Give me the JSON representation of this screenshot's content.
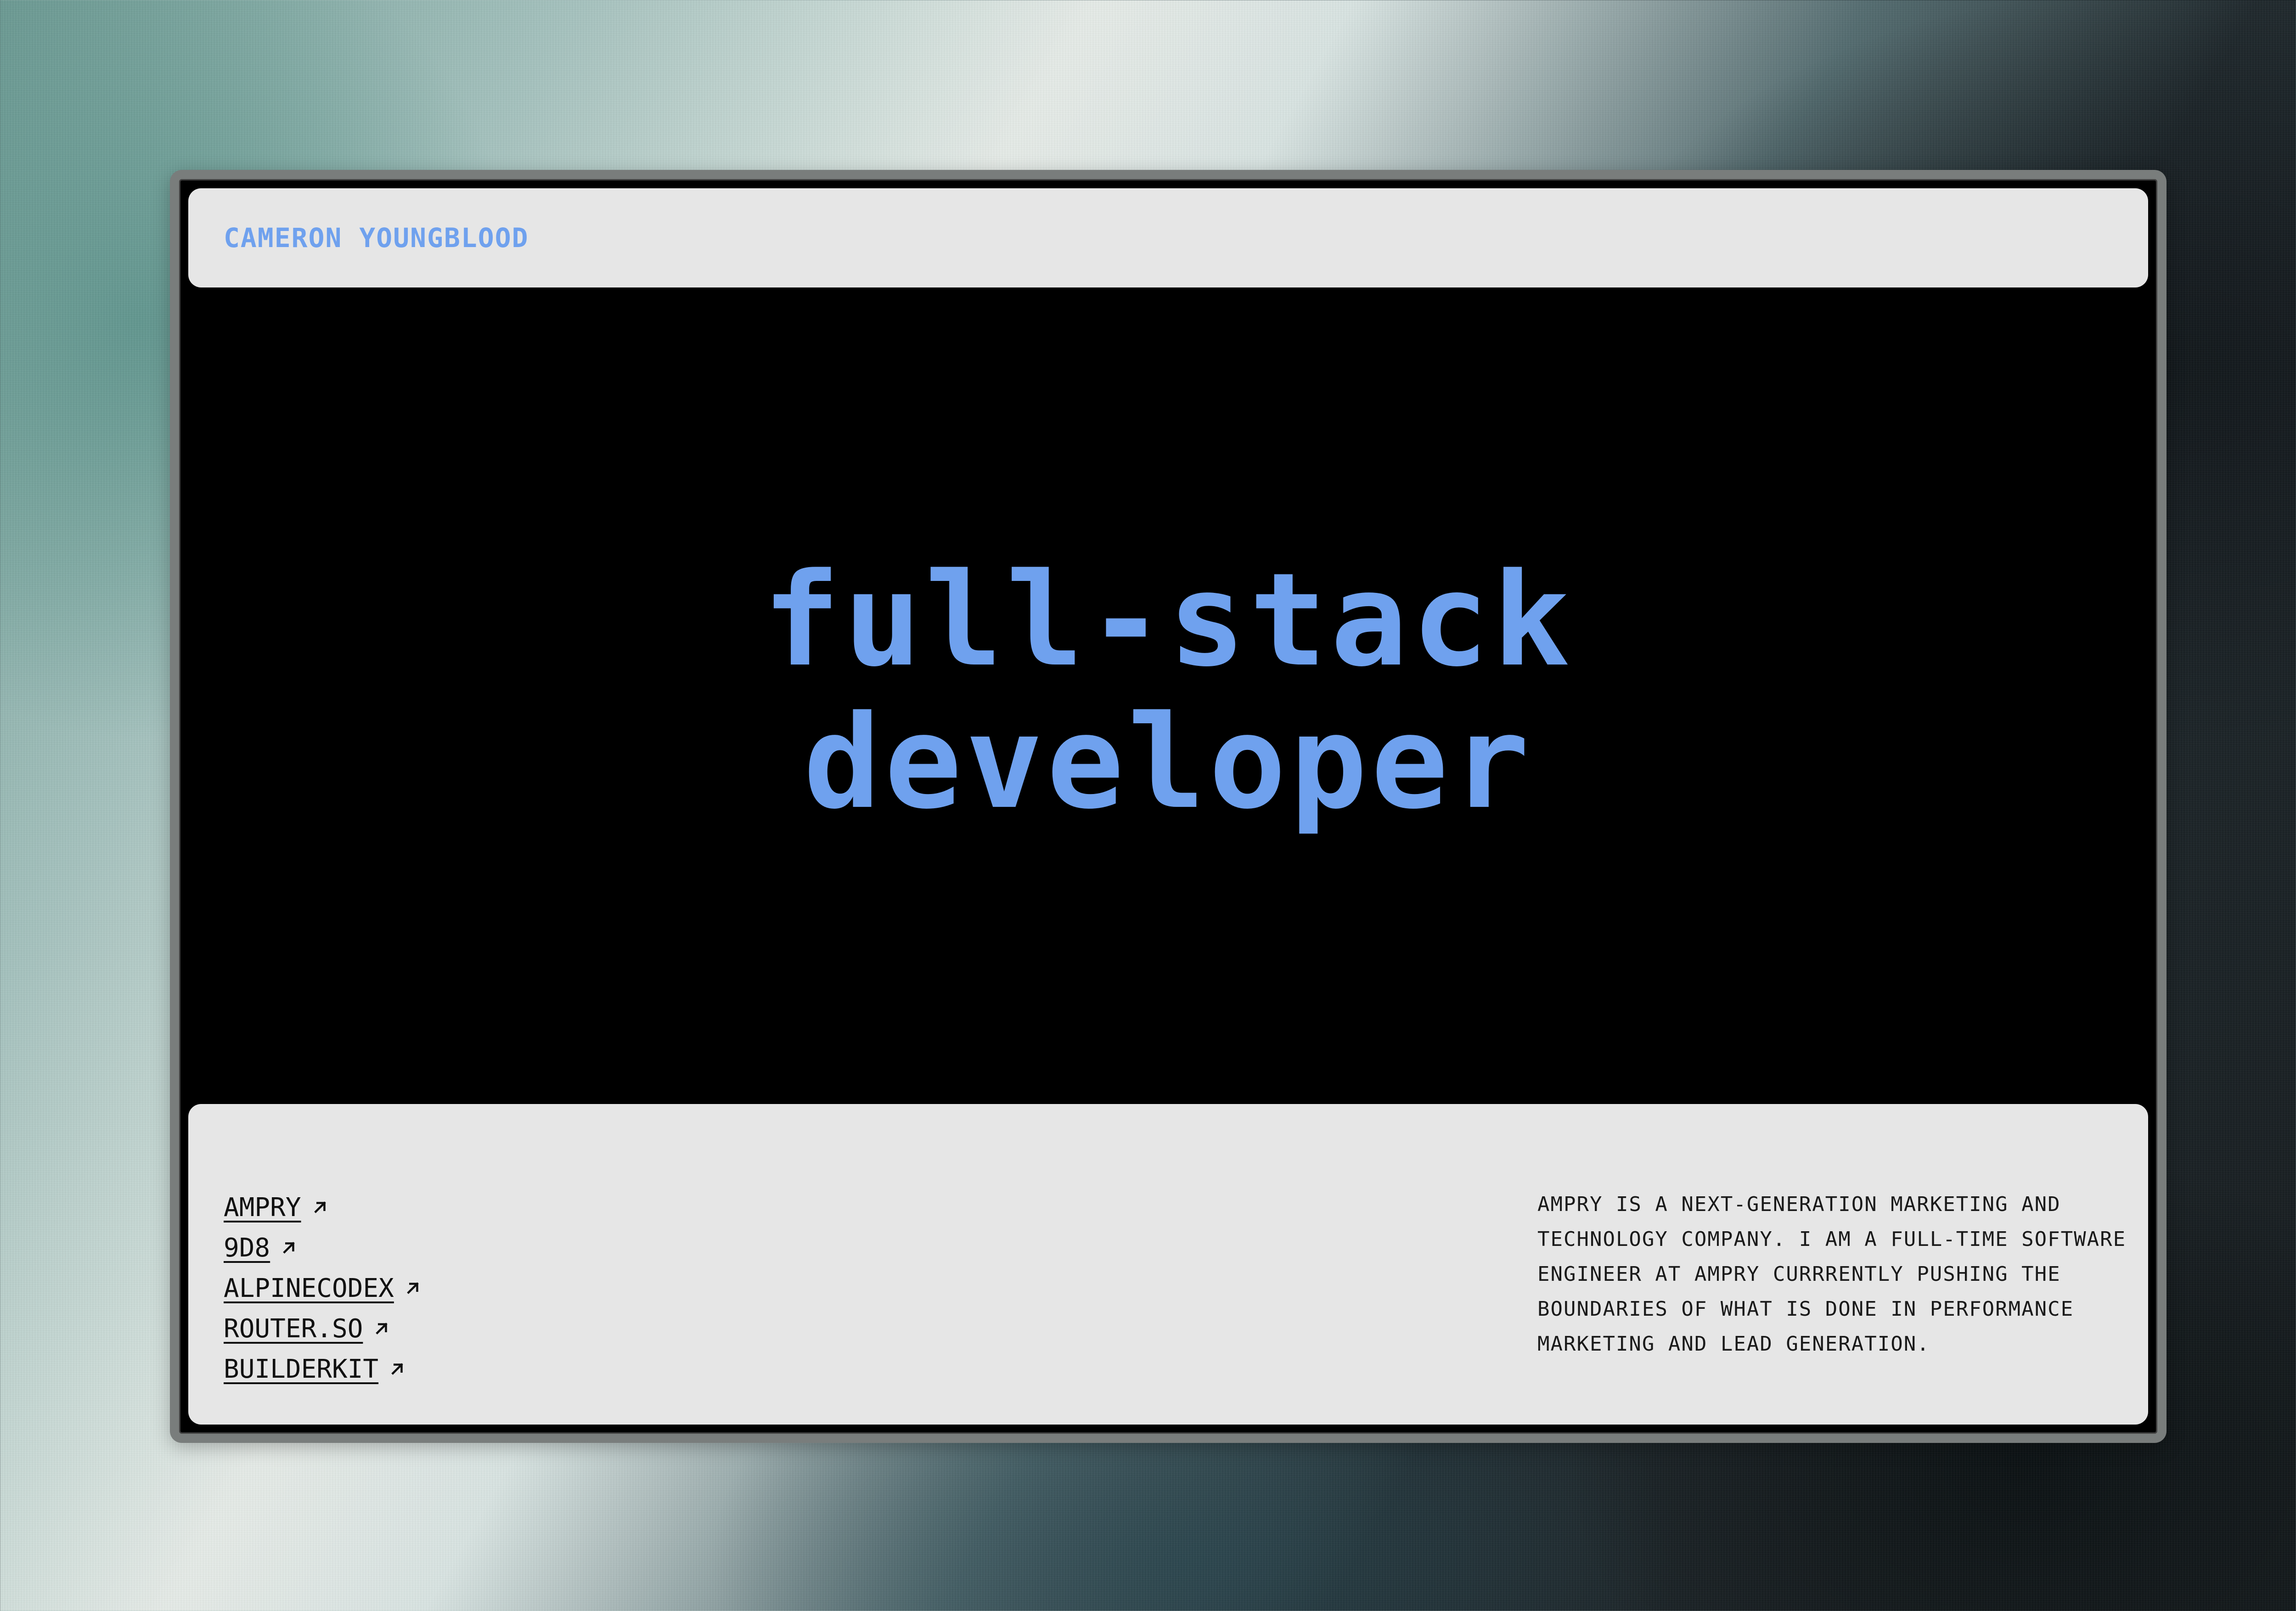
{
  "header": {
    "brand": "CAMERON YOUNGBLOOD"
  },
  "hero": {
    "line1": "full-stack",
    "line2": "developer"
  },
  "footer": {
    "links": [
      {
        "label": "AMPRY",
        "icon": "external-link-arrow-icon"
      },
      {
        "label": "9D8",
        "icon": "external-link-arrow-icon"
      },
      {
        "label": "ALPINECODEX",
        "icon": "external-link-arrow-icon"
      },
      {
        "label": "ROUTER.SO",
        "icon": "external-link-arrow-icon"
      },
      {
        "label": "BUILDERKIT",
        "icon": "external-link-arrow-icon"
      }
    ],
    "description": "AMPRY IS A NEXT-GENERATION MARKETING AND TECHNOLOGY COMPANY. I AM A FULL-TIME SOFTWARE ENGINEER AT AMPRY CURRRENTLY PUSHING THE BOUNDARIES OF WHAT IS DONE IN PERFORMANCE MARKETING AND LEAD GENERATION."
  },
  "colors": {
    "accent": "#6fa1ee",
    "panel": "#e6e6e6",
    "hero_bg": "#000000",
    "text": "#111111"
  }
}
